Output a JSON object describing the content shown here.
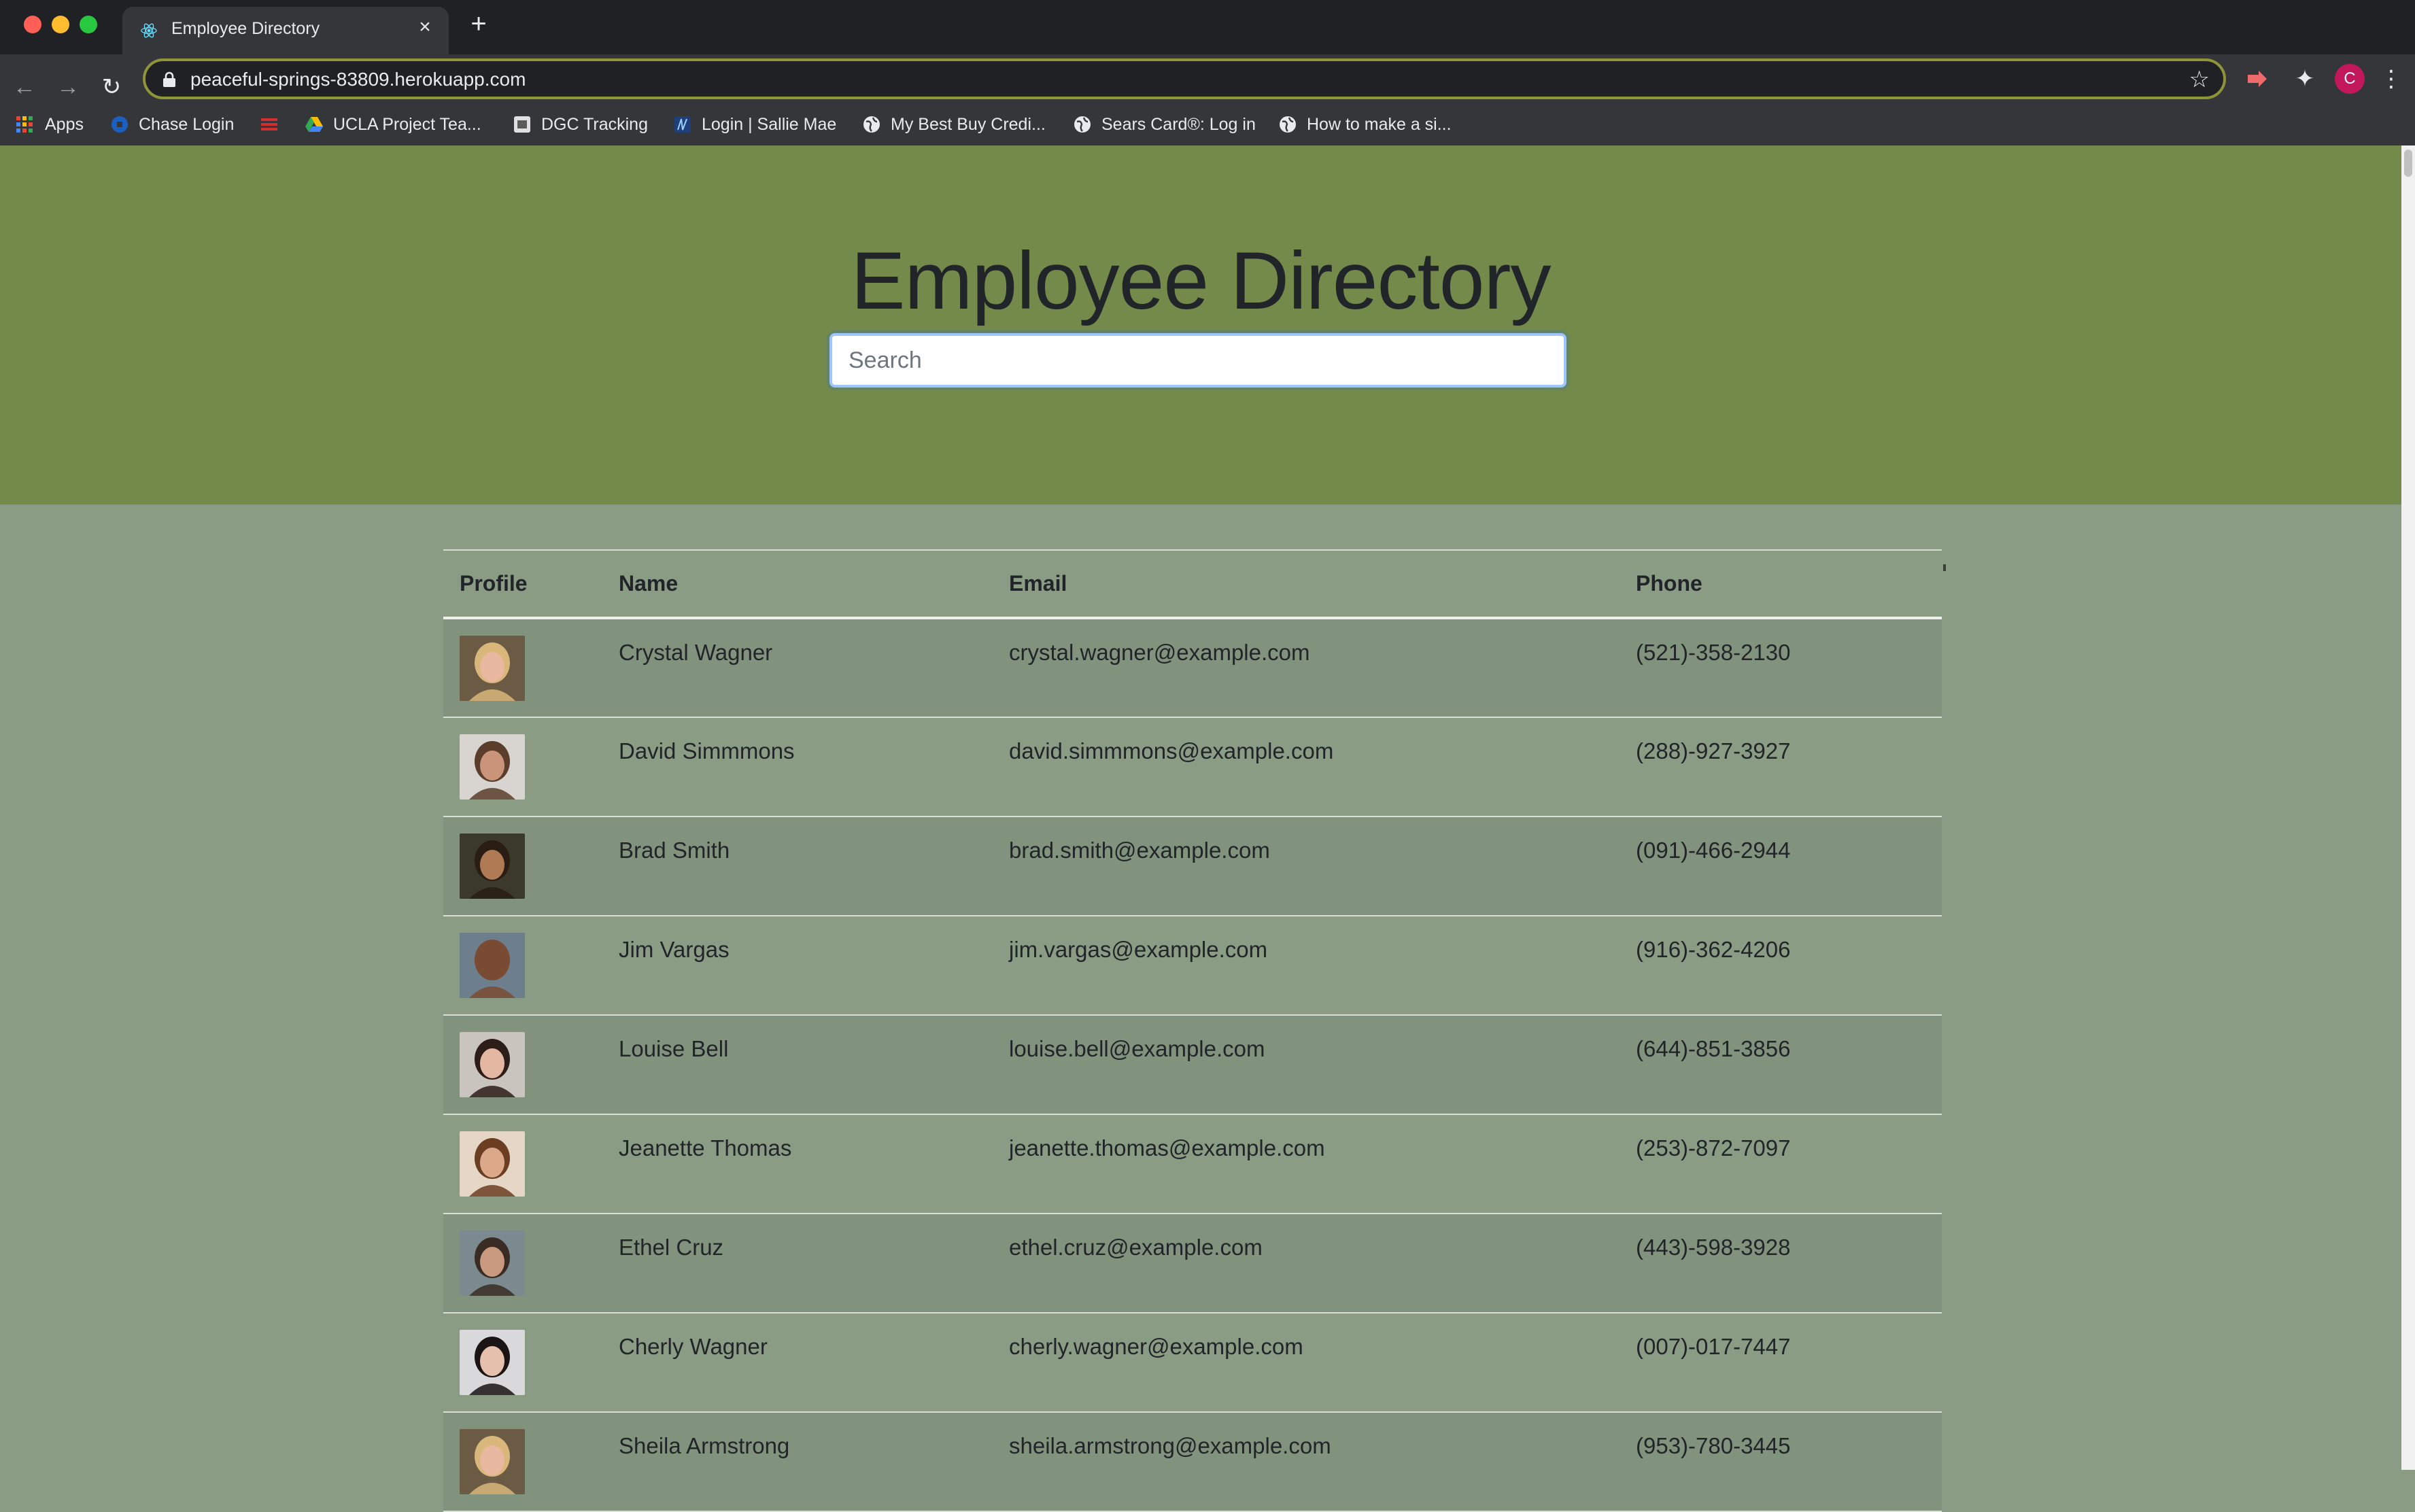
{
  "browser": {
    "tab_title": "Employee Directory",
    "url": "peaceful-springs-83809.herokuapp.com",
    "avatar_letter": "C",
    "bookmarks": [
      {
        "label": "Apps",
        "icon": "apps-grid-icon"
      },
      {
        "label": "Chase Login",
        "icon": "chase-logo-icon"
      },
      {
        "label": "",
        "icon": "red-bars-logo-icon"
      },
      {
        "label": "UCLA Project Tea...",
        "icon": "google-drive-icon"
      },
      {
        "label": "DGC Tracking",
        "icon": "tracking-icon"
      },
      {
        "label": "Login | Sallie Mae",
        "icon": "sallie-mae-icon"
      },
      {
        "label": "My Best Buy Credi...",
        "icon": "globe-icon"
      },
      {
        "label": "Sears Card®: Log in",
        "icon": "globe-icon"
      },
      {
        "label": "How to make a si...",
        "icon": "globe-icon"
      }
    ]
  },
  "hero": {
    "title": "Employee Directory",
    "search_placeholder": "Search",
    "search_value": ""
  },
  "table": {
    "headers": [
      "Profile",
      "Name",
      "Email",
      "Phone"
    ],
    "rows": [
      {
        "name": "Crystal Wagner",
        "email": "crystal.wagner@example.com",
        "phone": "(521)-358-2130",
        "photo": "woman-blonde-portrait"
      },
      {
        "name": "David Simmmons",
        "email": "david.simmmons@example.com",
        "phone": "(288)-927-3927",
        "photo": "man-beard-portrait"
      },
      {
        "name": "Brad Smith",
        "email": "brad.smith@example.com",
        "phone": "(091)-466-2944",
        "photo": "man-curly-portrait"
      },
      {
        "name": "Jim Vargas",
        "email": "jim.vargas@example.com",
        "phone": "(916)-362-4206",
        "photo": "man-bald-portrait"
      },
      {
        "name": "Louise Bell",
        "email": "louise.bell@example.com",
        "phone": "(644)-851-3856",
        "photo": "woman-dark-hair-portrait"
      },
      {
        "name": "Jeanette Thomas",
        "email": "jeanette.thomas@example.com",
        "phone": "(253)-872-7097",
        "photo": "woman-smiling-portrait"
      },
      {
        "name": "Ethel Cruz",
        "email": "ethel.cruz@example.com",
        "phone": "(443)-598-3928",
        "photo": "woman-glasses-portrait"
      },
      {
        "name": "Cherly Wagner",
        "email": "cherly.wagner@example.com",
        "phone": "(007)-017-7447",
        "photo": "woman-black-hair-portrait"
      },
      {
        "name": "Sheila Armstrong",
        "email": "sheila.armstrong@example.com",
        "phone": "(953)-780-3445",
        "photo": "woman-blonde-portrait"
      }
    ]
  },
  "colors": {
    "hero_bg": "#738a4a",
    "page_bg": "#8a9d84",
    "row_stripe": "#82937d",
    "text": "#212529",
    "chrome_dark": "#202124",
    "chrome_toolbar": "#35363a",
    "omnibox_border": "#8f9439"
  }
}
